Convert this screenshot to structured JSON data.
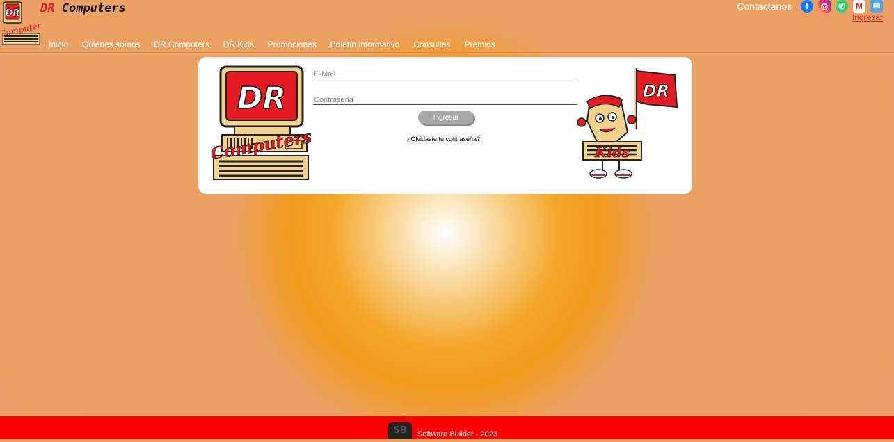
{
  "header": {
    "brand_dr": "DR",
    "brand_name": "Computers",
    "logo_text": "DR",
    "logo_script": "Computers",
    "nav": [
      "Inicio",
      "Quiénes somos",
      "DR Computers",
      "DR Kids",
      "Promociones",
      "Boletín informativo",
      "Consultas",
      "Premios"
    ],
    "contact_label": "Contactanos",
    "social_icons": [
      "facebook-icon",
      "instagram-icon",
      "whatsapp-icon",
      "gmail-icon",
      "email-icon"
    ],
    "login_link": "Ingresar"
  },
  "login": {
    "email_placeholder": "E-Mail",
    "password_placeholder": "Contraseña",
    "submit_label": "Ingresar",
    "forgot_link": "¿Olvidaste tu contraseña?",
    "left_logo_text": "DR",
    "left_logo_script": "Computers",
    "kids_flag_text": "DR",
    "kids_text": "Kids"
  },
  "footer": {
    "text": "Software Builder - 2023",
    "logo_text": "SB"
  },
  "colors": {
    "accent_red": "#e31b23",
    "orange": "#f29b1d",
    "footer_red": "#ff0000"
  }
}
